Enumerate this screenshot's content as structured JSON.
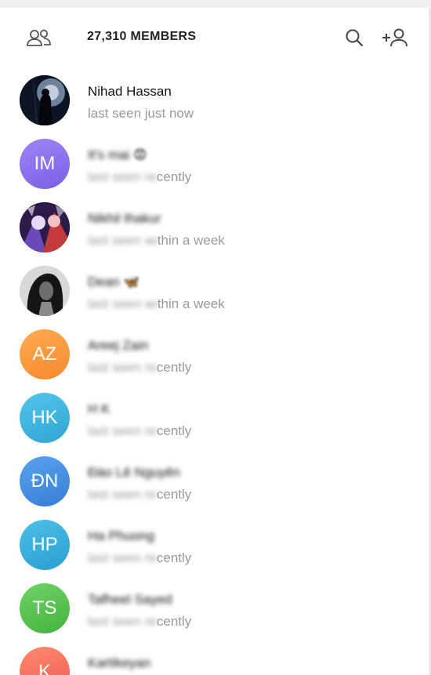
{
  "header": {
    "title": "27,310 MEMBERS",
    "icons": [
      "members-icon",
      "search-icon",
      "add-member-icon"
    ]
  },
  "members": [
    {
      "name": "Nihad Hassan",
      "status": "last seen just now",
      "initials": "",
      "avatar_type": "photo-dark-figure"
    },
    {
      "name": "It's mai",
      "name_suffix": "😡",
      "status_hidden": "last seen re",
      "status_visible": "cently",
      "initials": "IM",
      "color": "#8a6ef0"
    },
    {
      "name": "Nikhil thakur",
      "status_hidden": "last seen wi",
      "status_visible": "thin a week",
      "initials": "",
      "avatar_type": "photo-anime"
    },
    {
      "name": "Dean",
      "name_suffix": "🦋",
      "status_hidden": "last seen wi",
      "status_visible": "thin a week",
      "initials": "",
      "avatar_type": "photo-bw-portrait"
    },
    {
      "name": "Areej Zain",
      "status_hidden": "last seen re",
      "status_visible": "cently",
      "initials": "AZ",
      "color": "#f99a3f"
    },
    {
      "name": "H K",
      "status_hidden": "last seen re",
      "status_visible": "cently",
      "initials": "HK",
      "color": "#3bb3dd"
    },
    {
      "name": "Đào Lê Nguyên",
      "status_hidden": "last seen re",
      "status_visible": "cently",
      "initials": "ĐN",
      "color": "#3f8ce0"
    },
    {
      "name": "Ha Phuong",
      "status_hidden": "last seen re",
      "status_visible": "cently",
      "initials": "HP",
      "color": "#30a9d8"
    },
    {
      "name": "Tafheel Sayed",
      "status_hidden": "last seen re",
      "status_visible": "cently",
      "initials": "TS",
      "color": "#54c24f"
    },
    {
      "name": "Kartikeyan",
      "status_hidden": "",
      "status_visible": "",
      "initials": "K",
      "color": "#f26b5b"
    }
  ]
}
